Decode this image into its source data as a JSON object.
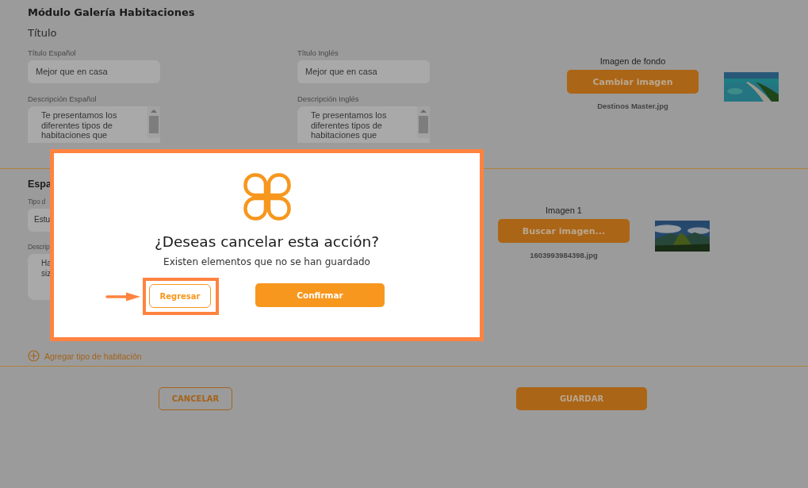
{
  "section_1": {
    "title": "Módulo Galería Habitaciones",
    "subtitle": "Título",
    "fields": [
      {
        "label": "Título Español",
        "kind": "input",
        "value": "Mejor que en casa"
      },
      {
        "label": "Título Inglés",
        "kind": "input",
        "value": "Mejor que en casa"
      },
      {
        "label": "Descripción Español",
        "kind": "textarea",
        "value": "Te presentamos los diferentes tipos de habitaciones que"
      },
      {
        "label": "Descripción Inglés",
        "kind": "textarea",
        "value": "Te presentamos los diferentes tipos de habitaciones que"
      }
    ],
    "image": {
      "label": "Imagen de fondo",
      "button": "Cambiar imagen",
      "filename": "Destinos Master.jpg",
      "kind": "beach"
    }
  },
  "section_2": {
    "title": "Espa",
    "fields": [
      {
        "label": "Tipo d",
        "kind": "input",
        "value": "Estu"
      },
      {
        "label": "Descrip",
        "kind": "textarea",
        "value": "Ha siz"
      }
    ],
    "image": {
      "label": "Imagen 1",
      "button": "Buscar imagen...",
      "filename": "1603993984398.jpg",
      "kind": "mountain"
    }
  },
  "add_link": "Agregar tipo de habitación",
  "footer": {
    "cancel": "CANCELAR",
    "save": "GUARDAR"
  },
  "dialog": {
    "title": "¿Deseas cancelar esta acción?",
    "message": "Existen elementos que no se han guardado",
    "buttons": [
      {
        "label": "Regresar",
        "kind": "outline",
        "highlighted": true
      },
      {
        "label": "Confirmar",
        "kind": "primary",
        "highlighted": false
      }
    ]
  }
}
